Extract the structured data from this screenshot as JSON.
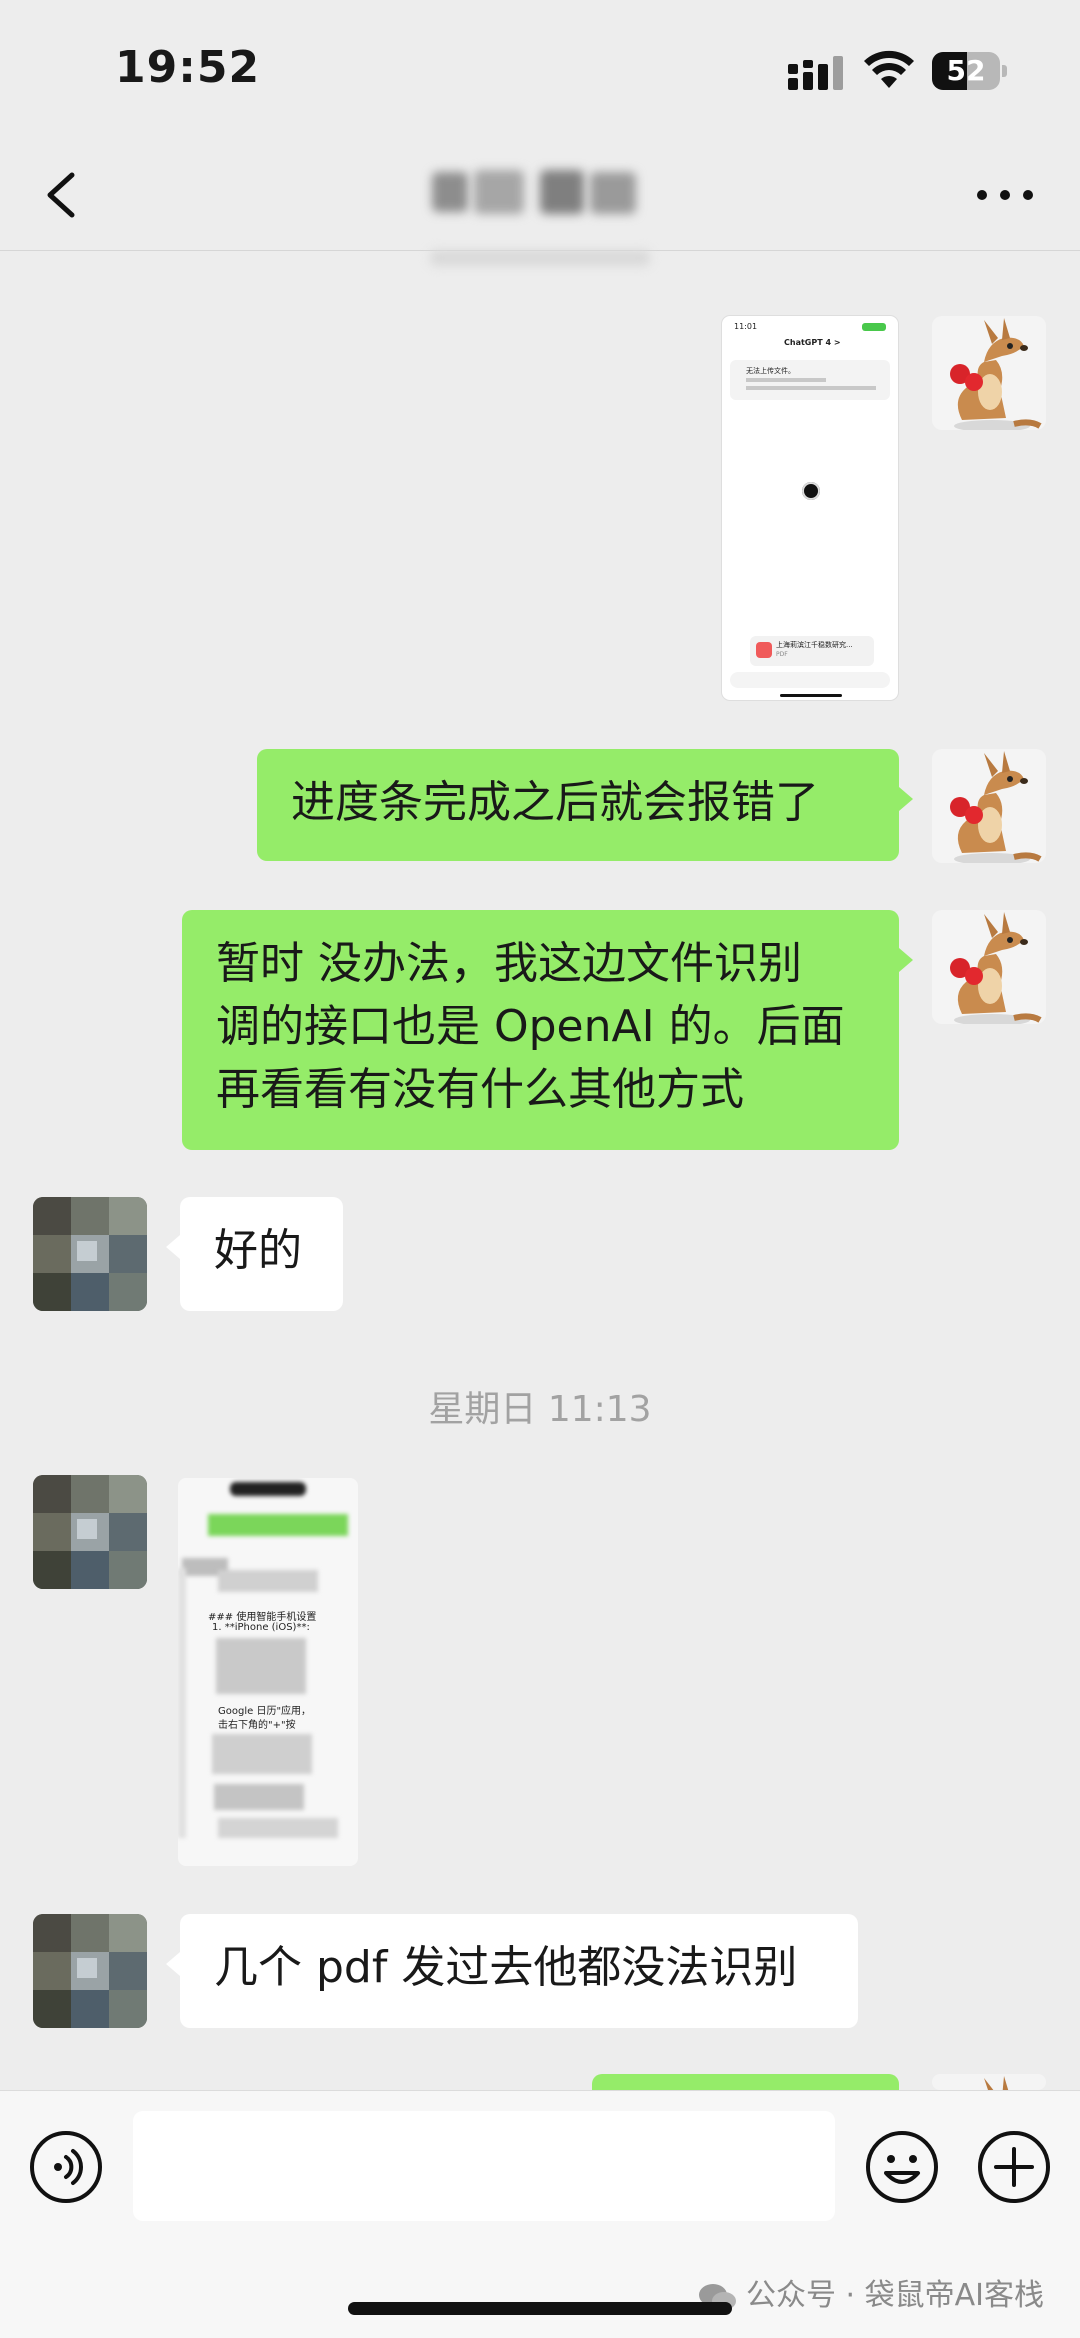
{
  "status": {
    "time": "19:52",
    "battery": "52",
    "battery_level": 0.52
  },
  "chat": {
    "messages": [
      {
        "side": "me",
        "type": "image",
        "screenshot": {
          "time": "11:01",
          "app_title": "ChatGPT 4 >",
          "notice": "无法上传文件。",
          "attachment": "上海莉滨江千稳数研究...",
          "attachment_type": "PDF"
        }
      },
      {
        "side": "me",
        "type": "text",
        "text": "进度条完成之后就会报错了"
      },
      {
        "side": "me",
        "type": "text",
        "lines": [
          "暂时 没办法，我这边文件识别",
          "调的接口也是 OpenAI 的。后面",
          "再看看有没有什么其他方式"
        ]
      },
      {
        "side": "them",
        "type": "text",
        "text": "好的"
      },
      {
        "side": "them",
        "type": "image",
        "snippets": [
          "### 使用智能手机设置",
          "1. **iPhone (iOS)**:",
          "Google 日历\"应用，",
          "击右下角的\"+\"按"
        ]
      },
      {
        "side": "them",
        "type": "text",
        "text": "几个 pdf 发过去他都没法识别"
      }
    ],
    "timestamp": "星期日 11:13"
  },
  "watermark": "公众号 · 袋鼠帝AI客栈",
  "colors": {
    "sent_bubble": "#95ec69",
    "received_bubble": "#ffffff",
    "background": "#ededed"
  }
}
